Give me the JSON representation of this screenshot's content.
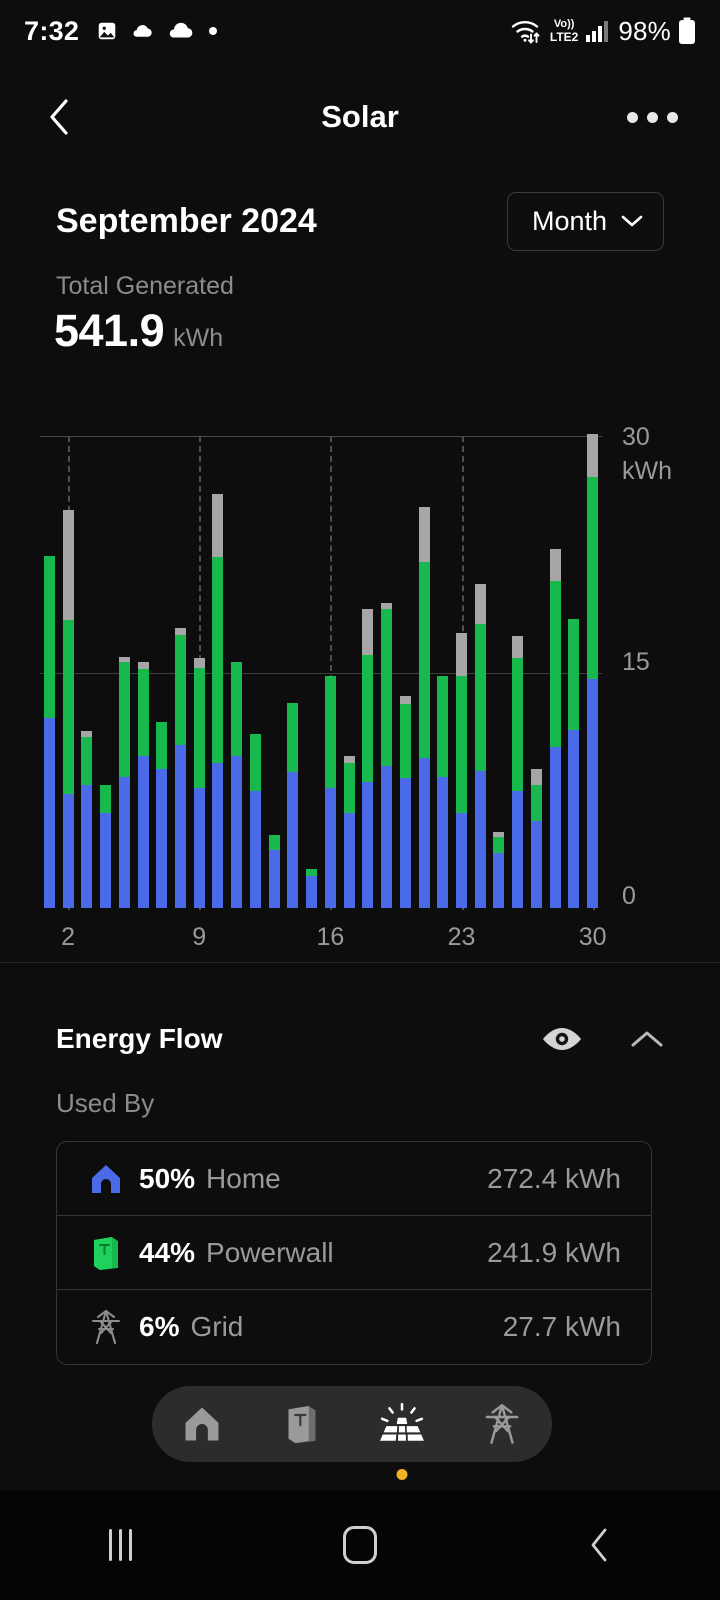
{
  "status_bar": {
    "time": "7:32",
    "left_icons": [
      "image-icon",
      "cloud-small-icon",
      "cloud-icon",
      "dot-icon"
    ],
    "wifi_icon": "wifi-updown-icon",
    "volte_line1": "Vo))",
    "volte_line2": "LTE2",
    "signal_icon": "signal-bars-icon",
    "battery_text": "98%",
    "battery_icon": "battery-full-icon"
  },
  "header": {
    "back_icon": "back-chevron-icon",
    "title": "Solar",
    "more_icon": "more-options-icon"
  },
  "summary": {
    "month_title": "September 2024",
    "period_label": "Month",
    "period_chevron": "chevron-down-icon",
    "total_label": "Total Generated",
    "total_value": "541.9",
    "total_unit": "kWh"
  },
  "chart_data": {
    "type": "bar",
    "title": "Solar generation by day — September 2024",
    "subtitle": "Total Generated 541.9 kWh",
    "stacked": true,
    "xlabel": "",
    "ylabel": "kWh",
    "ylim": [
      0,
      30
    ],
    "yticks": [
      0,
      15,
      30
    ],
    "ytick_labels": [
      "0",
      "15",
      "30"
    ],
    "y_unit_label": "kWh",
    "grid": true,
    "gridlines_horizontal": [
      15,
      30
    ],
    "gridlines_vertical_days": [
      2,
      9,
      16,
      23,
      30
    ],
    "legend_position": "none",
    "categories": [
      1,
      2,
      3,
      4,
      5,
      6,
      7,
      8,
      9,
      10,
      11,
      12,
      13,
      14,
      15,
      16,
      17,
      18,
      19,
      20,
      21,
      22,
      23,
      24,
      25,
      26,
      27,
      28,
      29,
      30
    ],
    "xtick_labels": [
      "2",
      "9",
      "16",
      "23",
      "30"
    ],
    "series": [
      {
        "name": "Home",
        "color": "#4a6ae8",
        "values": [
          12.0,
          7.2,
          7.8,
          6.0,
          8.3,
          9.6,
          8.8,
          10.3,
          7.6,
          9.2,
          9.6,
          7.4,
          3.7,
          8.6,
          2.0,
          7.6,
          6.0,
          8.0,
          9.0,
          8.2,
          9.5,
          8.3,
          6.0,
          8.7,
          3.5,
          7.4,
          5.5,
          10.2,
          11.3,
          14.8
        ]
      },
      {
        "name": "Powerwall",
        "color": "#18b84e",
        "values": [
          10.3,
          11.0,
          3.0,
          1.8,
          7.3,
          5.5,
          3.0,
          7.0,
          7.6,
          13.0,
          6.0,
          3.6,
          0.9,
          4.4,
          0.5,
          7.1,
          3.2,
          8.0,
          9.9,
          4.7,
          12.4,
          6.4,
          8.7,
          9.3,
          1.0,
          8.4,
          2.3,
          10.5,
          7.0,
          13.0
        ]
      },
      {
        "name": "Grid Export",
        "color": "#a6a6a6",
        "values": [
          0.0,
          7.0,
          0.4,
          0.0,
          0.3,
          0.5,
          0.0,
          0.4,
          0.6,
          4.0,
          0.0,
          0.0,
          0.0,
          0.0,
          0.0,
          0.0,
          0.4,
          2.9,
          0.4,
          0.5,
          3.5,
          0.0,
          2.7,
          2.5,
          0.3,
          1.4,
          1.0,
          2.0,
          0.0,
          2.8
        ]
      }
    ]
  },
  "energy_flow": {
    "title": "Energy Flow",
    "eye_icon": "eye-icon",
    "collapse_icon": "chevron-up-icon",
    "used_by_label": "Used By",
    "rows": [
      {
        "icon": "home-icon",
        "percent": "50%",
        "name": "Home",
        "value": "272.4 kWh",
        "color": "#4a6ae8"
      },
      {
        "icon": "powerwall-icon",
        "percent": "44%",
        "name": "Powerwall",
        "value": "241.9 kWh",
        "color": "#18b84e"
      },
      {
        "icon": "grid-icon",
        "percent": "6%",
        "name": "Grid",
        "value": "27.7 kWh",
        "color": "#8c8c8c"
      }
    ]
  },
  "tab_bar": {
    "tabs": [
      {
        "icon": "home-icon",
        "active": false
      },
      {
        "icon": "powerwall-icon",
        "active": false
      },
      {
        "icon": "solar-icon",
        "active": true
      },
      {
        "icon": "grid-icon",
        "active": false
      }
    ],
    "active_dot_color": "#f0b323"
  },
  "android_nav": {
    "recents_icon": "recents-icon",
    "home_icon": "android-home-icon",
    "back_icon": "android-back-icon"
  }
}
